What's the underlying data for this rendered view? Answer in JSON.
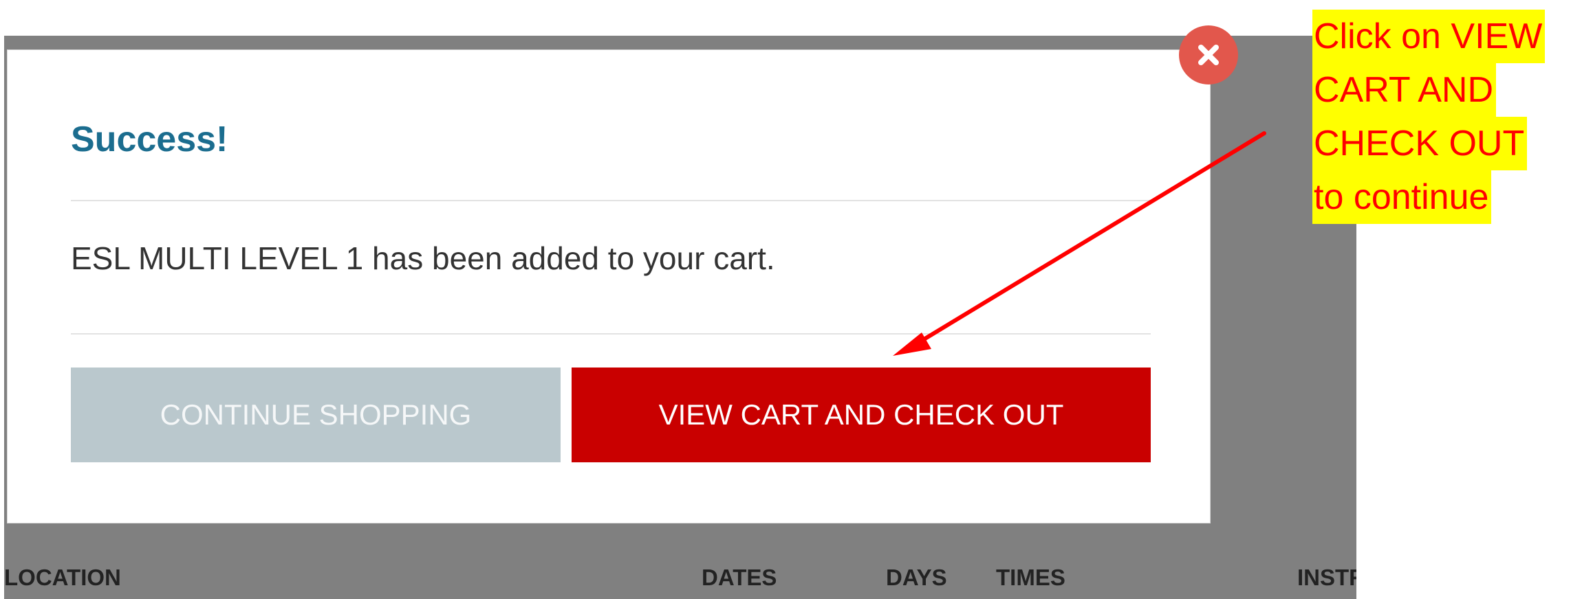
{
  "modal": {
    "title": "Success!",
    "message": "ESL MULTI LEVEL 1 has been added to your cart.",
    "close_icon": "close-x-icon",
    "buttons": {
      "continue_label": "CONTINUE SHOPPING",
      "view_cart_label": "VIEW CART AND CHECK OUT"
    }
  },
  "table_header": {
    "columns": [
      "LOCATION",
      "DATES",
      "DAYS",
      "TIMES",
      "INSTRUCTOR"
    ]
  },
  "annotation": {
    "lines": [
      "Click on VIEW",
      "CART AND",
      "CHECK OUT",
      "to continue"
    ]
  },
  "colors": {
    "title": "#1b6d8f",
    "primary_button": "#c90000",
    "secondary_button": "#bac8cd",
    "close_button": "#e2574c",
    "overlay": "#808080",
    "annotation_text": "#ff0000",
    "annotation_highlight": "#ffff00"
  }
}
